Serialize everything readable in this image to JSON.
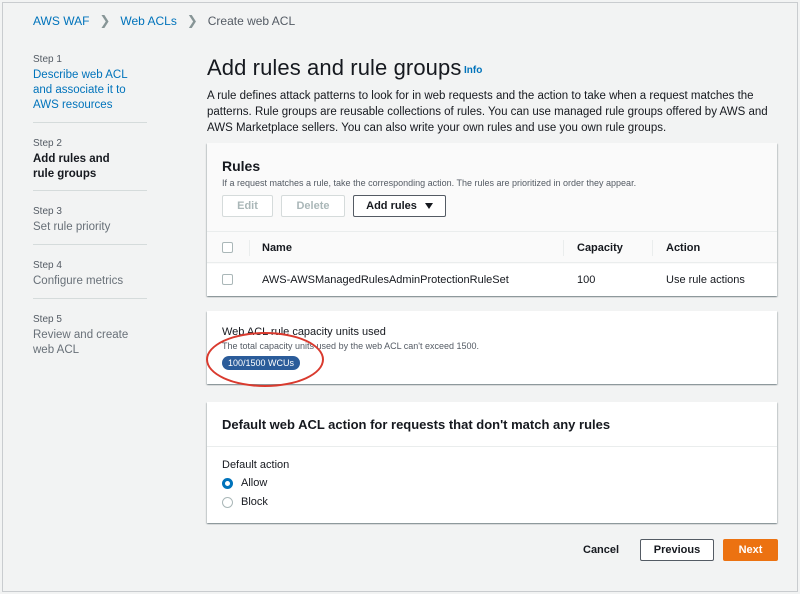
{
  "breadcrumb": {
    "items": [
      "AWS WAF",
      "Web ACLs"
    ],
    "current": "Create web ACL"
  },
  "steps": [
    {
      "num": "Step 1",
      "title": "Describe web ACL and associate it to AWS resources",
      "state": "link"
    },
    {
      "num": "Step 2",
      "title": "Add rules and rule groups",
      "state": "active"
    },
    {
      "num": "Step 3",
      "title": "Set rule priority",
      "state": "disabled"
    },
    {
      "num": "Step 4",
      "title": "Configure metrics",
      "state": "disabled"
    },
    {
      "num": "Step 5",
      "title": "Review and create web ACL",
      "state": "disabled"
    }
  ],
  "page": {
    "title": "Add rules and rule groups",
    "info": "Info",
    "description": "A rule defines attack patterns to look for in web requests and the action to take when a request matches the patterns. Rule groups are reusable collections of rules. You can use managed rule groups offered by AWS and AWS Marketplace sellers. You can also write your own rules and use you own rule groups."
  },
  "rules": {
    "heading": "Rules",
    "subtitle": "If a request matches a rule, take the corresponding action. The rules are prioritized in order they appear.",
    "edit_label": "Edit",
    "delete_label": "Delete",
    "add_label": "Add rules",
    "columns": [
      "Name",
      "Capacity",
      "Action"
    ],
    "rows": [
      {
        "name": "AWS-AWSManagedRulesAdminProtectionRuleSet",
        "capacity": "100",
        "action": "Use rule actions"
      }
    ]
  },
  "wcu": {
    "title": "Web ACL rule capacity units used",
    "subtitle": "The total capacity units used by the web ACL can't exceed 1500.",
    "badge": "100/1500 WCUs"
  },
  "default_action": {
    "heading": "Default web ACL action for requests that don't match any rules",
    "label": "Default action",
    "options": [
      "Allow",
      "Block"
    ],
    "selected": "Allow"
  },
  "footer": {
    "cancel_label": "Cancel",
    "previous_label": "Previous",
    "next_label": "Next"
  },
  "colors": {
    "link": "#0073bb",
    "primary_button": "#ec7211",
    "badge": "#2b5c9a",
    "annotation": "#d93a2e"
  },
  "icons": {
    "breadcrumb_separator": "chevron-right-icon",
    "add_rules_caret": "caret-down-icon"
  }
}
